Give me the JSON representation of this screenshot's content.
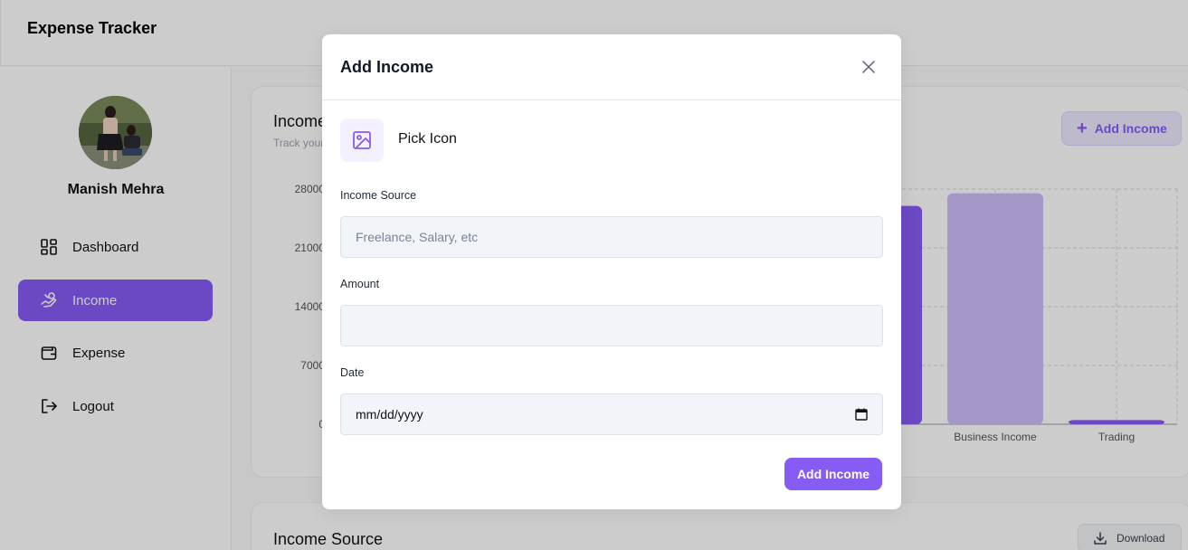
{
  "app": {
    "title": "Expense Tracker"
  },
  "user": {
    "name": "Manish Mehra"
  },
  "sidebar": {
    "items": [
      {
        "label": "Dashboard",
        "icon": "dashboard-icon",
        "active": false
      },
      {
        "label": "Income",
        "icon": "income-icon",
        "active": true
      },
      {
        "label": "Expense",
        "icon": "wallet-icon",
        "active": false
      },
      {
        "label": "Logout",
        "icon": "logout-icon",
        "active": false
      }
    ]
  },
  "income_card": {
    "title": "Income Overview",
    "subtitle": "Track your",
    "add_button": "Add Income"
  },
  "income_source_card": {
    "title": "Income Source",
    "download_button": "Download"
  },
  "chart_data": {
    "type": "bar",
    "categories": [
      "Business Income",
      "Trading"
    ],
    "series": [
      {
        "values": [
          26000,
          27500,
          500
        ]
      }
    ],
    "visible_bars": [
      {
        "category": "",
        "value": 26000,
        "color": "#875cf5"
      },
      {
        "category": "Business Income",
        "value": 27500,
        "color": "#cfbefb"
      },
      {
        "category": "Trading",
        "value": 500,
        "color": "#875cf5"
      }
    ],
    "y_ticks": [
      "28000",
      "21000",
      "14000",
      "7000",
      "0"
    ],
    "ylim": [
      0,
      28000
    ],
    "grid": true
  },
  "modal": {
    "title": "Add Income",
    "pick_icon_label": "Pick Icon",
    "fields": {
      "source_label": "Income Source",
      "source_placeholder": "Freelance, Salary, etc",
      "source_value": "",
      "amount_label": "Amount",
      "amount_value": "",
      "date_label": "Date",
      "date_placeholder": "mm/dd/yyyy"
    },
    "submit_label": "Add Income"
  },
  "colors": {
    "primary": "#875cf5",
    "primary_light": "#cfbefb",
    "field_bg": "#f1f4f8"
  }
}
